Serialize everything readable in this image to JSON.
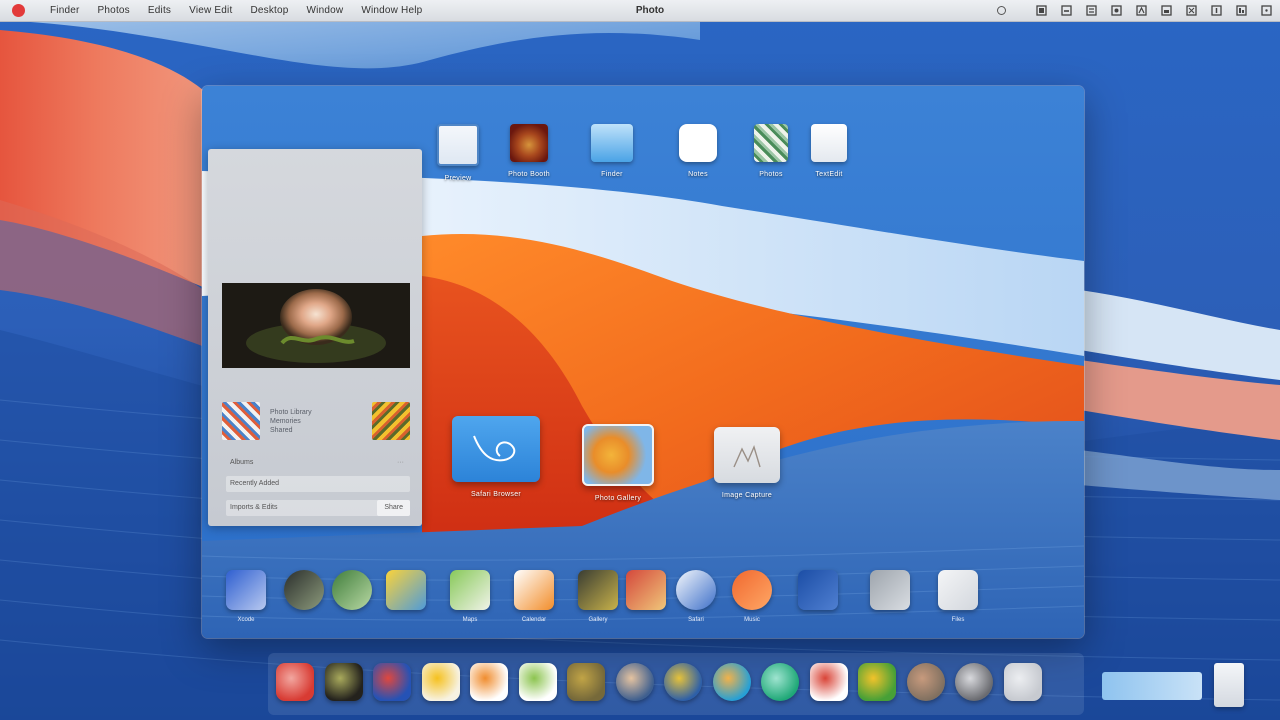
{
  "menubar": {
    "menus": [
      "Finder",
      "Photos",
      "Edits",
      "View Edit",
      "Desktop",
      "Window",
      "Window Help"
    ],
    "title": "Photo",
    "status_icon_count": 10
  },
  "launchpad": {
    "top_apps": [
      {
        "label": "Preview",
        "icon": "preview-icon",
        "colors": [
          "#f4f7fb",
          "#4f86c6"
        ]
      },
      {
        "label": "Photo Booth",
        "icon": "photo-booth-icon",
        "colors": [
          "#7a1f12",
          "#d6943b"
        ]
      },
      {
        "label": "Finder",
        "icon": "finder-icon",
        "colors": [
          "#4aa3e6",
          "#bfe2fa"
        ]
      },
      {
        "label": "Notes",
        "icon": "notes-icon",
        "colors": [
          "#ffffff",
          "#e9ecf0"
        ]
      },
      {
        "label": "Photos",
        "icon": "photos-icon",
        "colors": [
          "#eef2ea",
          "#4a8c59"
        ]
      },
      {
        "label": "TextEdit",
        "icon": "textedit-icon",
        "colors": [
          "#ffffff",
          "#dfe4ea"
        ]
      }
    ],
    "featured_apps": [
      {
        "label": "Safari Browser",
        "icon": "safari-icon"
      },
      {
        "label": "Photo Gallery",
        "icon": "gallery-icon"
      },
      {
        "label": "Image Capture",
        "icon": "image-capture-icon"
      }
    ],
    "sidebar": {
      "photo_icon": "rose-photo",
      "preview_text": [
        "Photo Library",
        "Memories",
        "Shared"
      ],
      "section_heading": "Albums",
      "section_more": "···",
      "rows": [
        {
          "text": "Recently Added",
          "button": ""
        },
        {
          "text": "Imports & Edits",
          "button": "Share"
        }
      ]
    },
    "grid_apps": [
      {
        "label": "Xcode",
        "icon": "xcode-icon",
        "shape": "square",
        "colors": [
          "#2f5fd0",
          "#b8c9f0"
        ]
      },
      {
        "label": "",
        "icon": "dark-globe-icon",
        "shape": "round",
        "colors": [
          "#2a2e2c",
          "#8d9b7c"
        ]
      },
      {
        "label": "",
        "icon": "maps-icon",
        "shape": "round",
        "colors": [
          "#3f7d3b",
          "#b9d9a4"
        ]
      },
      {
        "label": "",
        "icon": "color-icon",
        "shape": "square",
        "colors": [
          "#fbd33a",
          "#4f9bd9"
        ]
      },
      {
        "label": "Maps",
        "icon": "map-icon",
        "shape": "square",
        "colors": [
          "#88c95a",
          "#f0f3e8"
        ]
      },
      {
        "label": "Calendar",
        "icon": "calendar-icon",
        "shape": "square",
        "colors": [
          "#ffffff",
          "#f28d2a"
        ]
      },
      {
        "label": "Gallery",
        "icon": "dark-photo-icon",
        "shape": "square",
        "colors": [
          "#3a3d33",
          "#c8b24a"
        ]
      },
      {
        "label": "",
        "icon": "game-icon",
        "shape": "square",
        "colors": [
          "#d4483c",
          "#f0c77a"
        ]
      },
      {
        "label": "Safari",
        "icon": "compass-icon",
        "shape": "round",
        "colors": [
          "#f5f8fc",
          "#3d6fc9"
        ]
      },
      {
        "label": "Music",
        "icon": "orange-music-icon",
        "shape": "round",
        "colors": [
          "#f0682f",
          "#ffa765"
        ]
      },
      {
        "label": "",
        "icon": "blue-app-icon",
        "shape": "square",
        "colors": [
          "#1c4ea6",
          "#4f7fd1"
        ]
      },
      {
        "label": "",
        "icon": "gray-app-icon",
        "shape": "square",
        "colors": [
          "#9ea5ad",
          "#d9dde2"
        ]
      },
      {
        "label": "Files",
        "icon": "document-icon",
        "shape": "square",
        "colors": [
          "#f4f5f7",
          "#d3d7dd"
        ]
      }
    ]
  },
  "dock": {
    "apps": [
      {
        "icon": "red-app-icon",
        "shape": "square",
        "colors": [
          "#d83b33",
          "#f2a7a0"
        ]
      },
      {
        "icon": "dark-app-icon",
        "shape": "square",
        "colors": [
          "#24221d",
          "#a9aa5c"
        ]
      },
      {
        "icon": "mixed-app-icon",
        "shape": "square",
        "colors": [
          "#2552b5",
          "#e0473e"
        ]
      },
      {
        "icon": "yellow-app-icon",
        "shape": "square",
        "colors": [
          "#f7f2e2",
          "#f5c11f"
        ]
      },
      {
        "icon": "orange-app-icon",
        "shape": "square",
        "colors": [
          "#ffffff",
          "#f08d2f"
        ]
      },
      {
        "icon": "calendar-dock-icon",
        "shape": "square",
        "colors": [
          "#ffffff",
          "#8cc44f"
        ]
      },
      {
        "icon": "photo-dock-icon",
        "shape": "square",
        "colors": [
          "#76693a",
          "#c1a446"
        ]
      },
      {
        "icon": "globe-dock-icon",
        "shape": "round",
        "colors": [
          "#3e5f8f",
          "#e5c3a0"
        ]
      },
      {
        "icon": "sunflower-icon",
        "shape": "round",
        "colors": [
          "#2d5fa8",
          "#e6c23a"
        ]
      },
      {
        "icon": "teal-app-icon",
        "shape": "round",
        "colors": [
          "#25a0d6",
          "#f2b24a"
        ]
      },
      {
        "icon": "green-app-icon",
        "shape": "round",
        "colors": [
          "#1fa877",
          "#9fe4d0"
        ]
      },
      {
        "icon": "white-app-icon",
        "shape": "square",
        "colors": [
          "#ffffff",
          "#d94437"
        ]
      },
      {
        "icon": "leaf-app-icon",
        "shape": "square",
        "colors": [
          "#47a037",
          "#f2c32a"
        ]
      },
      {
        "icon": "bronze-app-icon",
        "shape": "round",
        "colors": [
          "#807060",
          "#c79a7d"
        ]
      },
      {
        "icon": "disk-app-icon",
        "shape": "round",
        "colors": [
          "#6a6b70",
          "#d8d9dd"
        ]
      },
      {
        "icon": "gray-dock-icon",
        "shape": "square",
        "colors": [
          "#c7cad0",
          "#eceef1"
        ]
      }
    ]
  }
}
